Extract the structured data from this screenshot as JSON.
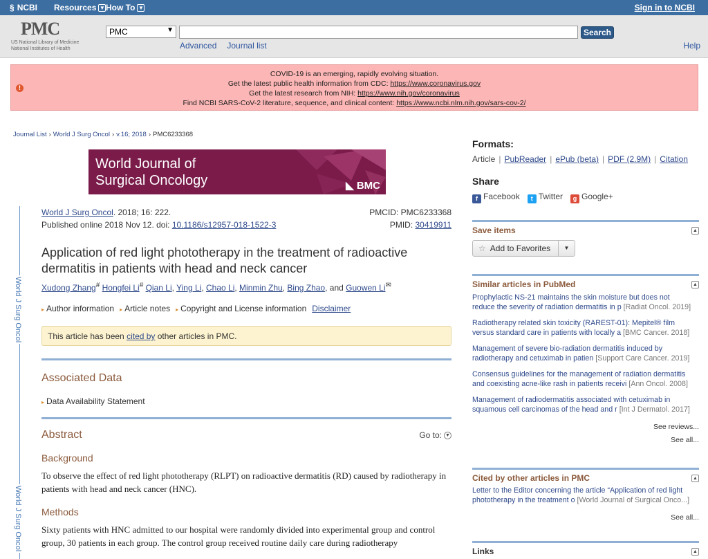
{
  "topbar": {
    "logo": "NCBI",
    "menu_resources": "Resources",
    "menu_howto": "How To",
    "signin": "Sign in to NCBI"
  },
  "header": {
    "logo_big": "PMC",
    "logo_line1": "US National Library of Medicine",
    "logo_line2": "National Institutes of Health",
    "db_selected": "PMC",
    "search_placeholder": "",
    "search_button": "Search",
    "advanced": "Advanced",
    "journal_list": "Journal list",
    "help": "Help"
  },
  "alert": {
    "line1": "COVID-19 is an emerging, rapidly evolving situation.",
    "line2_text": "Get the latest public health information from CDC: ",
    "line2_link": "https://www.coronavirus.gov",
    "line3_text": "Get the latest research from NIH: ",
    "line3_link": "https://www.nih.gov/coronavirus",
    "line4_text": "Find NCBI SARS-CoV-2 literature, sequence, and clinical content: ",
    "line4_link": "https://www.ncbi.nlm.nih.gov/sars-cov-2/"
  },
  "breadcrumb": {
    "c1": "Journal List",
    "c2": "World J Surg Oncol",
    "c3": "v.16; 2018",
    "c4": "PMC6233368"
  },
  "banner": {
    "line1": "World Journal of",
    "line2": "Surgical Oncology",
    "brand": "BMC"
  },
  "sidebar_journal": "World J Surg Oncol",
  "article": {
    "journal": "World J Surg Oncol",
    "citation": ". 2018; 16: 222.",
    "pmcid": "PMCID: PMC6233368",
    "published": "Published online 2018 Nov 12. doi: ",
    "doi": "10.1186/s12957-018-1522-3",
    "pmid_label": "PMID: ",
    "pmid": "30419911",
    "title": "Application of red light phototherapy in the treatment of radioactive dermatitis in patients with head and neck cancer",
    "authors": [
      "Xudong Zhang",
      "Hongfei Li",
      "Qian Li",
      "Ying Li",
      "Chao Li",
      "Minmin Zhu",
      "Bing Zhao",
      "Guowen Li"
    ],
    "and": "and",
    "info_author": "Author information",
    "info_notes": "Article notes",
    "info_copyright": "Copyright and License information",
    "info_disclaimer": "Disclaimer",
    "cited_pre": "This article has been ",
    "cited_link": "cited by",
    "cited_post": " other articles in PMC.",
    "assoc_heading": "Associated Data",
    "data_statement": "Data Availability Statement",
    "abstract_heading": "Abstract",
    "goto": "Go to:",
    "background_heading": "Background",
    "background_text": "To observe the effect of red light phototherapy (RLPT) on radioactive dermatitis (RD) caused by radiotherapy in patients with head and neck cancer (HNC).",
    "methods_heading": "Methods",
    "methods_text": "Sixty patients with HNC admitted to our hospital were randomly divided into experimental group and control group, 30 patients in each group. The control group received routine daily care during radiotherapy"
  },
  "right": {
    "formats_heading": "Formats:",
    "formats": [
      "Article",
      "PubReader",
      "ePub (beta)",
      "PDF (2.9M)",
      "Citation"
    ],
    "share_heading": "Share",
    "share": [
      "Facebook",
      "Twitter",
      "Google+"
    ],
    "save_heading": "Save items",
    "add_fav": "Add to Favorites",
    "similar_heading": "Similar articles in PubMed",
    "similar": [
      {
        "l1": "Prophylactic NS-21 maintains the skin moisture but does not",
        "l2": "reduce the severity of radiation dermatitis in p",
        "src": "[Radiat Oncol. 2019]"
      },
      {
        "l1": "Radiotherapy related skin toxicity (RAREST-01): Mepitel® film",
        "l2": "versus standard care in patients with locally a",
        "src": "[BMC Cancer. 2018]"
      },
      {
        "l1": "Management of severe bio-radiation dermatitis induced by",
        "l2": "radiotherapy and cetuximab in patien",
        "src": "[Support Care Cancer. 2019]"
      },
      {
        "l1": "Consensus guidelines for the management of radiation dermatitis",
        "l2": "and coexisting acne-like rash in patients receivi",
        "src": "[Ann Oncol. 2008]"
      },
      {
        "l1": "Management of radiodermatitis associated with cetuximab in",
        "l2": "squamous cell carcinomas of the head and r",
        "src": "[Int J Dermatol. 2017]"
      }
    ],
    "see_reviews": "See reviews...",
    "see_all": "See all...",
    "cited_heading": "Cited by other articles in PMC",
    "cited_l1": "Letter to the Editor concerning the article “Application of red light",
    "cited_l2": "phototherapy in the treatment o",
    "cited_src": "[World Journal of Surgical Onco...]",
    "cited_see_all": "See all...",
    "links_heading": "Links"
  }
}
